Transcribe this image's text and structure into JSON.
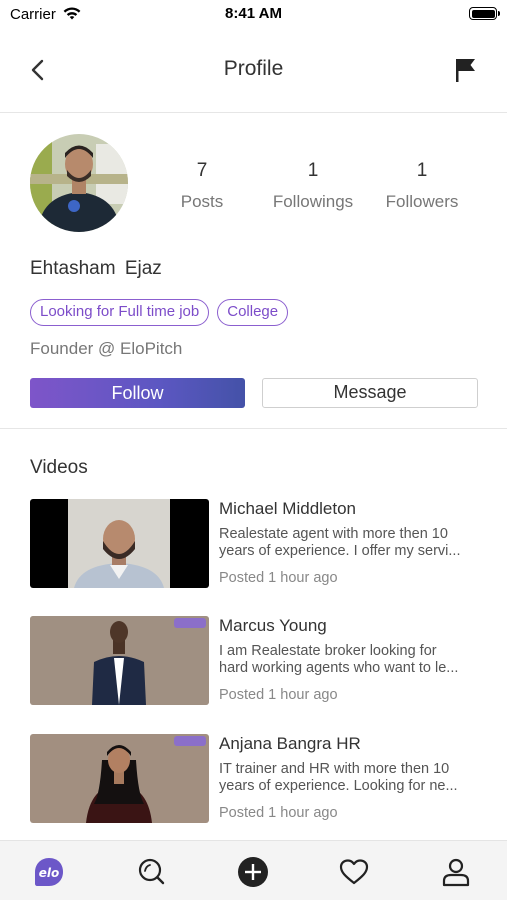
{
  "status_bar": {
    "carrier": "Carrier",
    "time": "8:41 AM"
  },
  "nav": {
    "title": "Profile"
  },
  "profile": {
    "first_name": "Ehtasham",
    "last_name": "Ejaz",
    "stats": [
      {
        "value": "7",
        "label": "Posts"
      },
      {
        "value": "1",
        "label": "Followings"
      },
      {
        "value": "1",
        "label": "Followers"
      }
    ],
    "tags": [
      "Looking for Full time job",
      "College"
    ],
    "bio": "Founder @ EloPitch",
    "follow_label": "Follow",
    "message_label": "Message"
  },
  "videos_section": {
    "title": "Videos",
    "items": [
      {
        "name": "Michael Middleton",
        "desc_line1": "Realestate agent with more then 10",
        "desc_line2": "years of experience. I offer my servi...",
        "time": "Posted 1 hour ago"
      },
      {
        "name": "Marcus Young",
        "desc_line1": "I am Realestate broker looking for",
        "desc_line2": "hard working agents who want to le...",
        "time": "Posted 1 hour ago"
      },
      {
        "name": "Anjana Bangra HR",
        "desc_line1": "IT trainer and HR with more then 10",
        "desc_line2": "years of experience. Looking for ne...",
        "time": "Posted 1 hour ago"
      }
    ]
  },
  "tabbar": {
    "items": [
      "elo-logo-icon",
      "search-icon",
      "add-icon",
      "heart-icon",
      "person-icon"
    ]
  },
  "colors": {
    "accent": "#7c4cc9",
    "follow_gradient_end": "#4452a8"
  }
}
